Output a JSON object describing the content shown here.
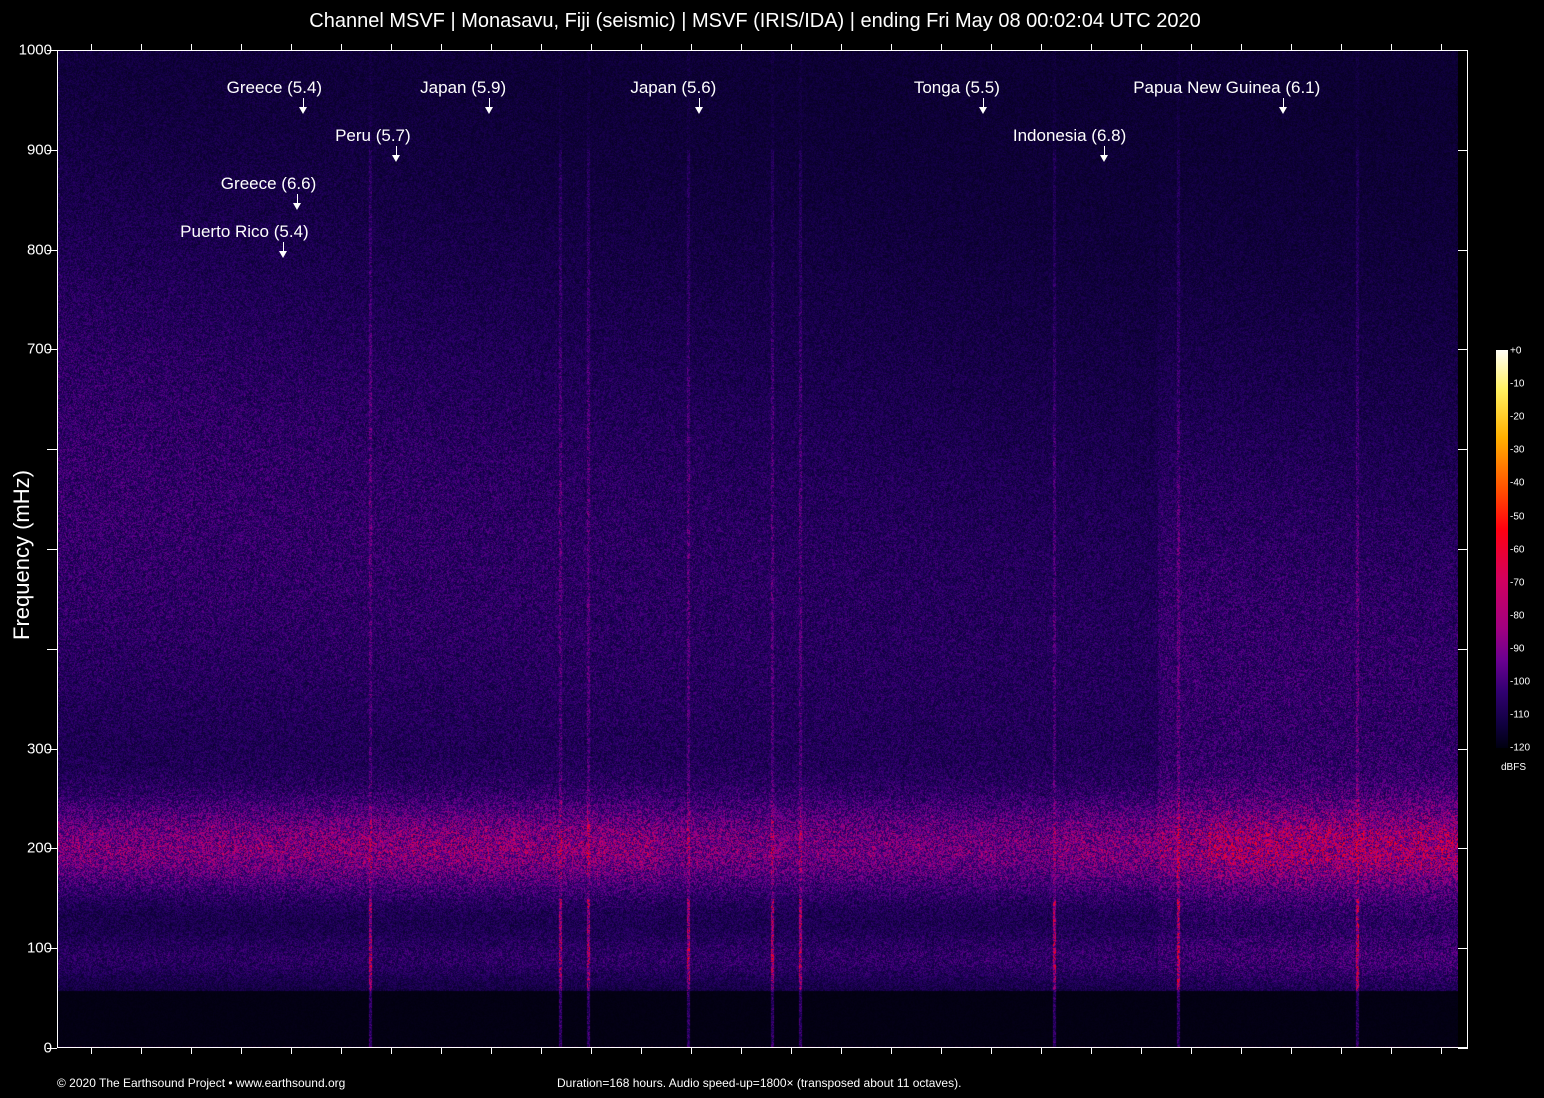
{
  "title": "Channel MSVF | Monasavu, Fiji (seismic) | MSVF (IRIS/IDA) | ending Fri May 08 00:02:04 UTC 2020",
  "chart_data": {
    "type": "heatmap",
    "title": "Channel MSVF | Monasavu, Fiji (seismic) | MSVF (IRIS/IDA) | ending Fri May 08 00:02:04 UTC 2020",
    "ylabel": "Frequency (mHz)",
    "ylim": [
      0,
      1000
    ],
    "xlim_hours": [
      0,
      168
    ],
    "ytick_values": [
      0,
      100,
      200,
      300,
      400,
      500,
      600,
      700,
      800,
      900,
      1000
    ],
    "ytick_labels": [
      "0",
      "100",
      "200",
      "300",
      "",
      "",
      "",
      "700",
      "800",
      "900",
      "1000"
    ],
    "colorbar": {
      "unit": "dBFS",
      "range": [
        -120,
        0
      ],
      "labels": [
        "+0",
        "-10",
        "-20",
        "-30",
        "-40",
        "-50",
        "-60",
        "-70",
        "-80",
        "-90",
        "-100",
        "-110",
        "-120"
      ]
    },
    "noise_band_center_mHz": 200,
    "events": [
      {
        "label": "Puerto Rico (5.4)",
        "hour": 27.1
      },
      {
        "label": "Greece (6.6)",
        "hour": 28.8
      },
      {
        "label": "Greece (5.4)",
        "hour": 29.5
      },
      {
        "label": "Peru (5.7)",
        "hour": 40.6
      },
      {
        "label": "Japan (5.9)",
        "hour": 51.8
      },
      {
        "label": "Japan (5.6)",
        "hour": 77.0
      },
      {
        "label": "Tonga (5.5)",
        "hour": 111.0
      },
      {
        "label": "Indonesia (6.8)",
        "hour": 125.5
      },
      {
        "label": "Papua New Guinea (6.1)",
        "hour": 147.0
      }
    ]
  },
  "footer": {
    "copyright": "© 2020 The Earthsound Project • www.earthsound.org",
    "info": "Duration=168 hours. Audio speed-up=1800× (transposed about 11 octaves)."
  }
}
